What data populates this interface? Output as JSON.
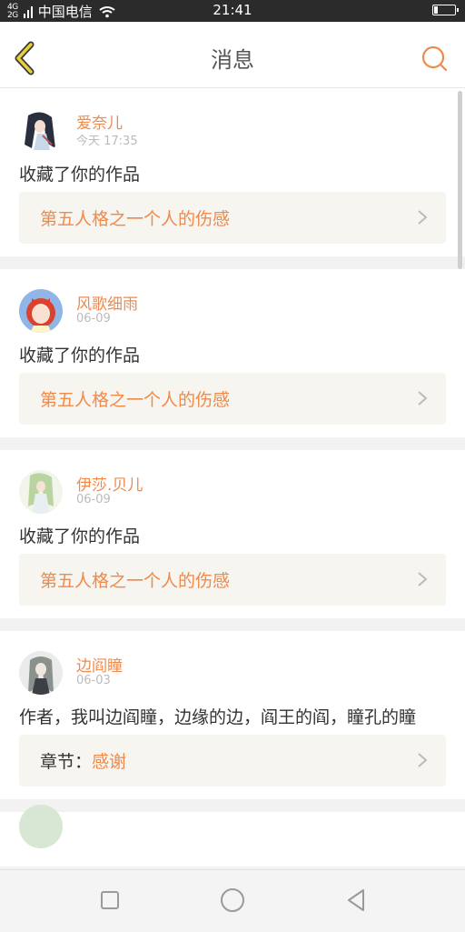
{
  "status_bar": {
    "network_top": "4G",
    "network_bottom": "2G",
    "carrier": "中国电信",
    "time": "21:41"
  },
  "header": {
    "title": "消息"
  },
  "colors": {
    "accent": "#f08a4b",
    "back_icon": "#e0c23a"
  },
  "messages": [
    {
      "user": "爱奈儿",
      "time": "今天 17:35",
      "text": "收藏了你的作品",
      "work_prefix": "",
      "work_title": "第五人格之一个人的伤感",
      "avatar_icon": "avatar-anime-girl-dark-hair"
    },
    {
      "user": "风歌细雨",
      "time": "06-09",
      "text": "收藏了你的作品",
      "work_prefix": "",
      "work_title": "第五人格之一个人的伤感",
      "avatar_icon": "avatar-anime-girl-red-hair"
    },
    {
      "user": "伊莎.贝儿",
      "time": "06-09",
      "text": "收藏了你的作品",
      "work_prefix": "",
      "work_title": "第五人格之一个人的伤感",
      "avatar_icon": "avatar-anime-girl-green-hair"
    },
    {
      "user": "边阎瞳",
      "time": "06-03",
      "text": "作者，我叫边阎瞳，边缘的边，阎王的阎，瞳孔的瞳",
      "work_prefix": "章节：",
      "work_title": "感谢",
      "avatar_icon": "avatar-anime-girl-grey-hair"
    }
  ],
  "navigation_bar": {
    "buttons": [
      "recent-apps-icon",
      "home-icon",
      "back-triangle-icon"
    ]
  }
}
